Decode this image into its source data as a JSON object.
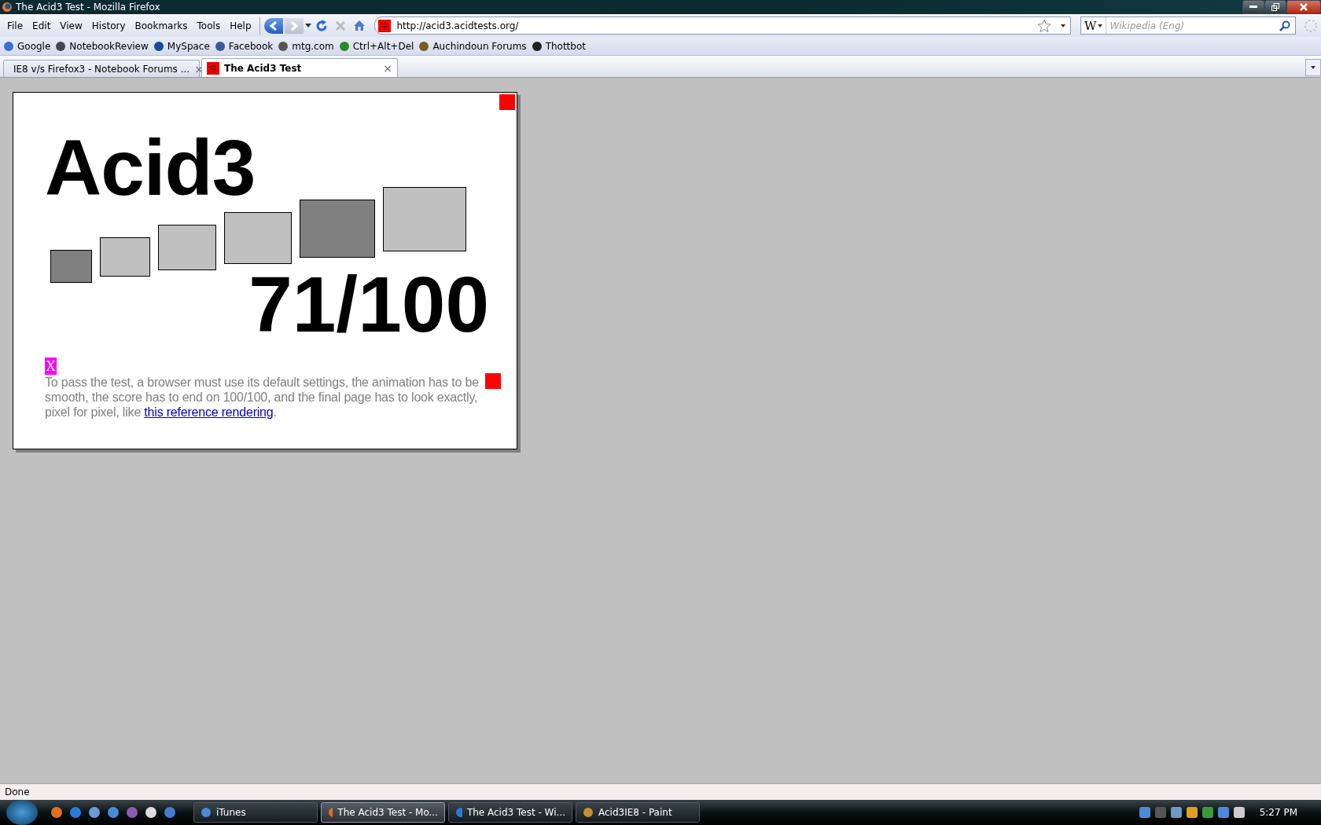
{
  "window": {
    "title": "The Acid3 Test - Mozilla Firefox"
  },
  "menu": [
    "File",
    "Edit",
    "View",
    "History",
    "Bookmarks",
    "Tools",
    "Help"
  ],
  "address": {
    "value": "http://acid3.acidtests.org/"
  },
  "search": {
    "engine": "W",
    "placeholder": "Wikipedia (Eng)"
  },
  "bookmarks": [
    "Google",
    "NotebookReview",
    "MySpace",
    "Facebook",
    "mtg.com",
    "Ctrl+Alt+Del",
    "Auchindoun Forums",
    "Thottbot"
  ],
  "tabs": [
    {
      "label": "IE8 v/s Firefox3 - Notebook Forums ...",
      "close": "×",
      "selected": false
    },
    {
      "label": "The Acid3 Test",
      "close": "×",
      "selected": true
    }
  ],
  "page": {
    "heading": "Acid3",
    "buckets": [
      {
        "color": "#808080"
      },
      {
        "color": "#c0c0c0"
      },
      {
        "color": "#c0c0c0"
      },
      {
        "color": "#c0c0c0"
      },
      {
        "color": "#808080"
      },
      {
        "color": "#c0c0c0"
      }
    ],
    "score": "71/100",
    "marker": "X",
    "text_before": "To pass the test, a browser must use its default settings, the animation has to be smooth, the score has to end on 100/100, and the final page has to look exactly, pixel for pixel, like ",
    "link": "this reference rendering",
    "text_after": "."
  },
  "status_bar": {
    "text": "Done"
  },
  "taskbar": {
    "tasks": [
      {
        "label": "iTunes",
        "selected": false
      },
      {
        "label": "The Acid3 Test - Mo...",
        "selected": true
      },
      {
        "label": "The Acid3 Test - Wi...",
        "selected": false
      },
      {
        "label": "Acid3IE8 - Paint",
        "selected": false
      }
    ],
    "clock": "5:27 PM"
  }
}
